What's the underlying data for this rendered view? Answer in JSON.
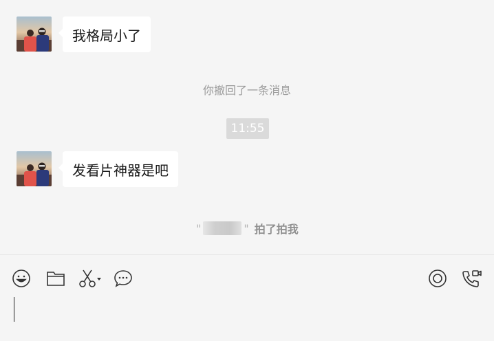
{
  "messages": [
    {
      "text": "我格局小了"
    },
    {
      "text": "发看片神器是吧"
    }
  ],
  "system": {
    "recalled": "你撤回了一条消息",
    "time": "11:55",
    "pat_quote_open": "\"",
    "pat_quote_close": "\"",
    "pat_suffix": "拍了拍我"
  },
  "toolbar": {
    "icons": [
      "emoji-icon",
      "folder-icon",
      "scissors-icon",
      "chat-bubble-icon",
      "live-icon",
      "video-call-icon"
    ]
  },
  "colors": {
    "background": "#f5f5f5",
    "bubble": "#ffffff",
    "system_text": "#9b9b9b",
    "time_chip": "#dadada"
  }
}
